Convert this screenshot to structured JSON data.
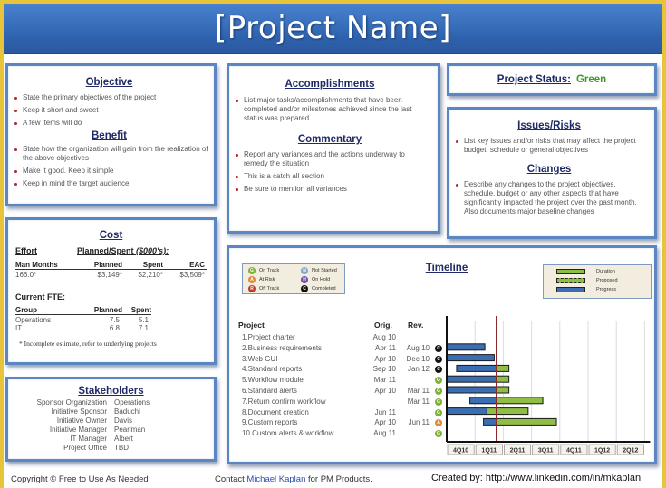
{
  "title": "[Project Name]",
  "objective": {
    "heading": "Objective",
    "items": [
      "State the primary objectives of the project",
      "Keep it short and sweet",
      " A few items will do"
    ]
  },
  "benefit": {
    "heading": "Benefit",
    "items": [
      "State how the organization will gain from the realization of the above objectives",
      "Make it good. Keep it simple",
      "Keep in mind the target audience"
    ]
  },
  "accomplishments": {
    "heading": "Accomplishments",
    "items": [
      "List major tasks/accomplishments that have been completed and/or milestones achieved since the last status was prepared"
    ]
  },
  "commentary": {
    "heading": "Commentary",
    "items": [
      "Report any variances and the actions underway to remedy the situation",
      "This is a catch all section",
      "Be  sure to mention all variances"
    ]
  },
  "status": {
    "label": "Project Status:",
    "value": "Green",
    "value_color": "#3a9a2a"
  },
  "issues": {
    "heading": "Issues/Risks",
    "items": [
      "List key issues and/or risks that may affect the project budget, schedule or general objectives"
    ]
  },
  "changes": {
    "heading": "Changes",
    "items": [
      "Describe any changes to the project objectives, schedule, budget or any other aspects that have significantly impacted the project over the past month. Also documents major baseline changes"
    ]
  },
  "cost": {
    "heading": "Cost",
    "effort_label": "Effort",
    "planned_spent_label": "Planned/Spent ",
    "planned_spent_unit": "($000's):",
    "cols": [
      "Man Months",
      "Planned",
      "Spent",
      "EAC"
    ],
    "values": [
      "166.0*",
      "$3,149*",
      "$2,210*",
      "$3,509*"
    ],
    "fte_label": "Current FTE:",
    "fte_cols": [
      "Group",
      "Planned",
      "Spent"
    ],
    "fte_rows": [
      {
        "group": "Operations",
        "planned": "7.5",
        "spent": "5.1"
      },
      {
        "group": "IT",
        "planned": "6.8",
        "spent": "7.1"
      }
    ],
    "note": "* Incomplete estimate, refer to underlying projects"
  },
  "stakeholders": {
    "heading": "Stakeholders",
    "rows": [
      {
        "role": "Sponsor Organization",
        "name": "Operations"
      },
      {
        "role": "Initiative Sponsor",
        "name": "Baduchi"
      },
      {
        "role": "Initiative Owner",
        "name": "Davis"
      },
      {
        "role": "Initiative Manager",
        "name": "Pearlman"
      },
      {
        "role": "IT Manager",
        "name": "Albert"
      },
      {
        "role": "Project Office",
        "name": "TBD"
      }
    ]
  },
  "timeline": {
    "heading": "Timeline",
    "status_legend": [
      {
        "code": "G",
        "label": "On Track",
        "color": "#7fb03a"
      },
      {
        "code": "A",
        "label": "At Risk",
        "color": "#e08a3c"
      },
      {
        "code": "R",
        "label": "Off Track",
        "color": "#c0392b"
      },
      {
        "code": "N",
        "label": "Not Started",
        "color": "#7fa9c8"
      },
      {
        "code": "H",
        "label": "On Hold",
        "color": "#6b4fa8"
      },
      {
        "code": "C",
        "label": "Completed",
        "color": "#111111"
      }
    ],
    "bar_legend": [
      {
        "label": "Duration",
        "style": "solid-green"
      },
      {
        "label": "Proposed",
        "style": "dashed-green"
      },
      {
        "label": "Progress",
        "style": "solid-blue"
      }
    ],
    "cols": [
      "Project",
      "Orig.",
      "Rev."
    ],
    "quarters": [
      "4Q10",
      "1Q11",
      "2Q11",
      "3Q11",
      "4Q11",
      "1Q12",
      "2Q12"
    ],
    "today_marker_quarter": 1.75,
    "projects": [
      {
        "name": "1.Project charter",
        "orig": "Aug 10",
        "rev": "",
        "status": "",
        "start": null,
        "progress_end": null,
        "end": null
      },
      {
        "name": "2.Business requirements",
        "orig": "Apr 11",
        "rev": "Aug 10",
        "status": "C",
        "start": 0.0,
        "progress_end": 1.35,
        "end": 1.35
      },
      {
        "name": "3.Web GUI",
        "orig": "Apr 10",
        "rev": "Dec 10",
        "status": "C",
        "start": 0.0,
        "progress_end": 1.68,
        "end": 1.68
      },
      {
        "name": "4.Standard reports",
        "orig": "Sep 10",
        "rev": "Jan 12",
        "status": "C",
        "start": 0.35,
        "progress_end": 1.75,
        "end": 2.2
      },
      {
        "name": "5.Workflow module",
        "orig": "Mar 11",
        "rev": "",
        "status": "G",
        "start": 0.0,
        "progress_end": 1.75,
        "end": 2.2
      },
      {
        "name": "6.Standard alerts",
        "orig": "Apr 10",
        "rev": "Mar 11",
        "status": "G",
        "start": 0.0,
        "progress_end": 1.75,
        "end": 2.2
      },
      {
        "name": "7.Return confirm workflow",
        "orig": "",
        "rev": "Mar 11",
        "status": "G",
        "start": 0.82,
        "progress_end": 1.75,
        "end": 3.4
      },
      {
        "name": "8.Document creation",
        "orig": "Jun 11",
        "rev": "",
        "status": "G",
        "start": 0.0,
        "progress_end": 1.42,
        "end": 2.88
      },
      {
        "name": "9.Custom reports",
        "orig": "Apr 10",
        "rev": "Jun 11",
        "status": "A",
        "start": 1.3,
        "progress_end": 1.75,
        "end": 3.88
      },
      {
        "name": "10 Custom alerts & workflow",
        "orig": "Aug 11",
        "rev": "",
        "status": "G",
        "start": null,
        "progress_end": null,
        "end": null
      }
    ]
  },
  "footer": {
    "copyright": "Copyright © Free to  Use As Needed",
    "contact_prefix": "Contact ",
    "contact_name": "Michael Kaplan",
    "contact_suffix": " for PM Products.",
    "created_by": "Created by: http://www.linkedin.com/in/mkaplan"
  }
}
